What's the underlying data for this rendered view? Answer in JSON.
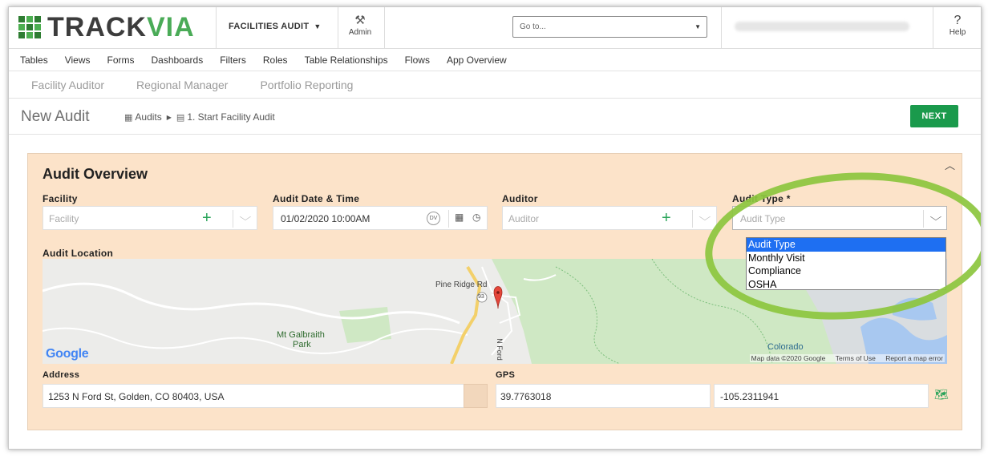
{
  "brand": {
    "part1": "TRACK",
    "part2": "VIA"
  },
  "header": {
    "app_name": "FACILITIES AUDIT",
    "admin_label": "Admin",
    "goto_placeholder": "Go to...",
    "help_label": "Help",
    "help_glyph": "?"
  },
  "nav": {
    "items": [
      "Tables",
      "Views",
      "Forms",
      "Dashboards",
      "Filters",
      "Roles",
      "Table Relationships",
      "Flows",
      "App Overview"
    ]
  },
  "roles": {
    "items": [
      "Facility Auditor",
      "Regional Manager",
      "Portfolio Reporting"
    ]
  },
  "page": {
    "title": "New Audit",
    "breadcrumb": [
      "Audits",
      "1. Start Facility Audit"
    ],
    "next_label": "NEXT"
  },
  "form": {
    "section_title": "Audit Overview",
    "facility": {
      "label": "Facility",
      "placeholder": "Facility"
    },
    "audit_date": {
      "label": "Audit Date & Time",
      "value": "01/02/2020 10:00AM",
      "badge": "DV"
    },
    "auditor": {
      "label": "Auditor",
      "placeholder": "Auditor"
    },
    "audit_type": {
      "label": "Audit Type *",
      "placeholder": "Audit Type",
      "options": [
        "Audit Type",
        "Monthly Visit",
        "Compliance",
        "OSHA"
      ],
      "highlighted_option": "Audit Type"
    },
    "location_label": "Audit Location",
    "map": {
      "labels": {
        "pine_ridge": "Pine Ridge Rd",
        "galbraith1": "Mt Galbraith",
        "galbraith2": "Park",
        "nford": "N Ford",
        "colorado": "Colorado",
        "route": "93"
      },
      "google": "Google",
      "attrib": {
        "data": "Map data ©2020 Google",
        "terms": "Terms of Use",
        "report": "Report a map error"
      }
    },
    "address": {
      "label": "Address",
      "value": "1253 N Ford St, Golden, CO 80403, USA"
    },
    "gps": {
      "label": "GPS",
      "lat": "39.7763018",
      "lng": "-105.2311941"
    }
  },
  "colors": {
    "accent_green": "#1a9a4c",
    "panel_bg": "#fce3c9",
    "highlight_ring": "#8dc63f",
    "selected_option": "#1e6ff2"
  }
}
